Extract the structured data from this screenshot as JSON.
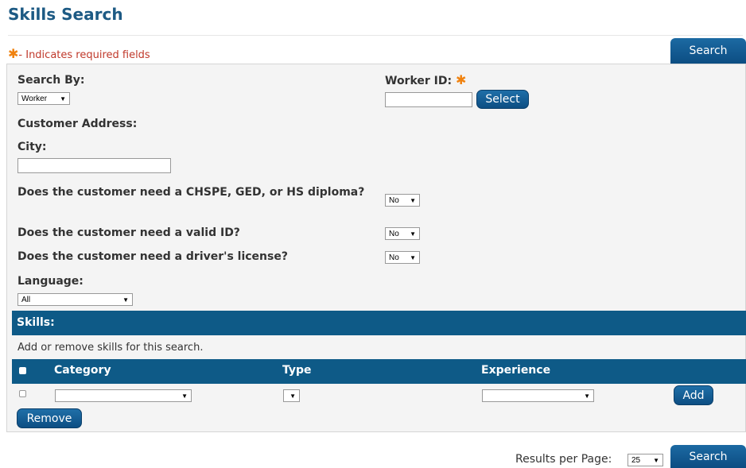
{
  "page": {
    "title": "Skills Search",
    "required_note": "- Indicates required fields",
    "required_mark": "✱",
    "search_button": "Search"
  },
  "form": {
    "search_by": {
      "label": "Search By:",
      "value": "Worker"
    },
    "worker_id": {
      "label": "Worker ID:",
      "value": "",
      "select_button": "Select"
    },
    "customer_address_label": "Customer Address:",
    "city": {
      "label": "City:",
      "value": ""
    },
    "diploma": {
      "label": "Does the customer need a CHSPE, GED, or HS diploma?",
      "value": "No"
    },
    "valid_id": {
      "label": "Does the customer need a valid ID?",
      "value": "No"
    },
    "drivers_license": {
      "label": "Does the customer need a driver's license?",
      "value": "No"
    },
    "language": {
      "label": "Language:",
      "value": "All"
    }
  },
  "skills": {
    "header": "Skills:",
    "instruction": "Add or remove skills for this search.",
    "columns": [
      "Category",
      "Type",
      "Experience"
    ],
    "row": {
      "category": "",
      "type": "",
      "experience": ""
    },
    "add_button": "Add",
    "remove_button": "Remove"
  },
  "footer": {
    "results_label": "Results per Page:",
    "results_value": "25",
    "search_button": "Search"
  },
  "colors": {
    "title": "#1d5a84",
    "required_note": "#c0392b",
    "required_star": "#f0820f",
    "bar": "#0e5a87",
    "button": "#0d4e83"
  }
}
